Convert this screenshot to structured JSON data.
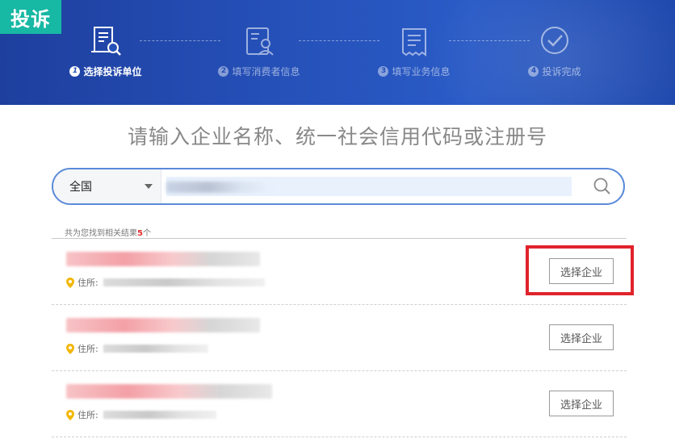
{
  "banner": {
    "badge": "投诉",
    "steps": [
      {
        "num": "1",
        "label": "选择投诉单位",
        "active": true,
        "icon": "document-search-icon"
      },
      {
        "num": "2",
        "label": "填写消费者信息",
        "active": false,
        "icon": "user-form-icon"
      },
      {
        "num": "3",
        "label": "填写业务信息",
        "active": false,
        "icon": "receipt-icon"
      },
      {
        "num": "4",
        "label": "投诉完成",
        "active": false,
        "icon": "check-circle-icon"
      }
    ]
  },
  "heading": "请输入企业名称、统一社会信用代码或注册号",
  "search": {
    "region": "全国",
    "value": "",
    "button_icon": "search-icon"
  },
  "results": {
    "prefix": "共为您找到相关结果",
    "count": "5",
    "suffix": "个",
    "address_label": "住所:",
    "select_label": "选择企业",
    "items": [
      {
        "row": 1
      },
      {
        "row": 2
      },
      {
        "row": 3
      }
    ]
  },
  "colors": {
    "banner": "#2550b8",
    "badge": "#17b8a4",
    "highlight": "#e0232c",
    "count": "#e03030"
  }
}
